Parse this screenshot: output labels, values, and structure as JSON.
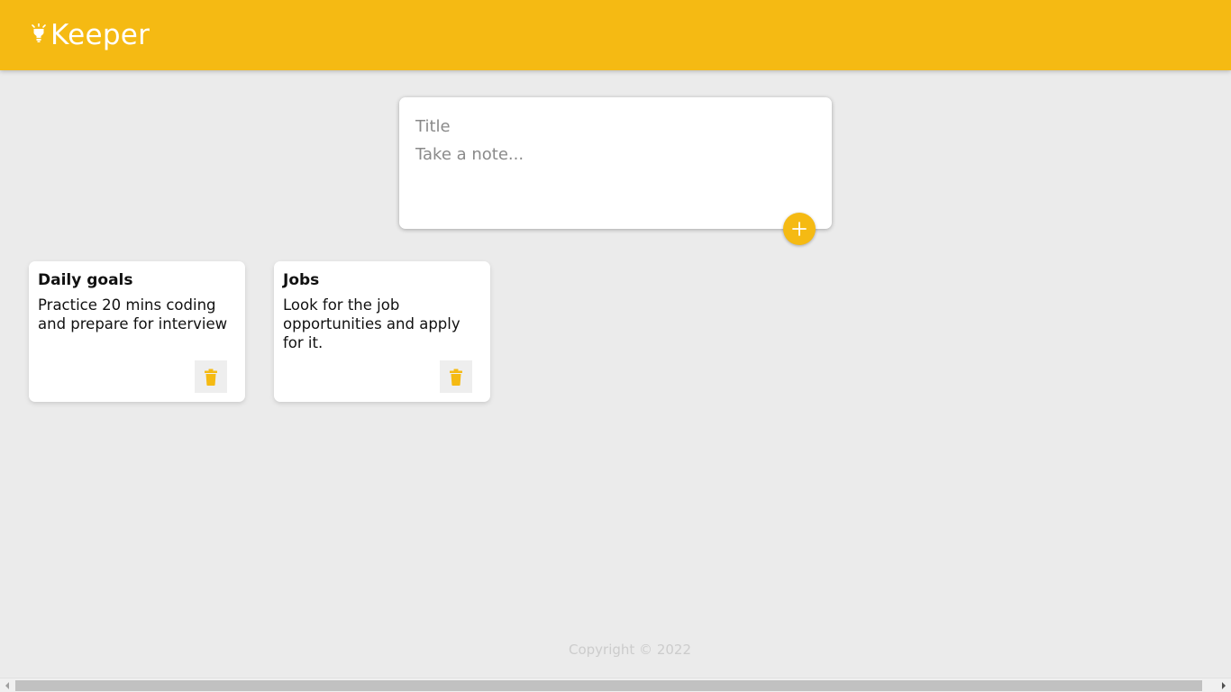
{
  "header": {
    "title": "Keeper",
    "icon": "lightbulb-icon"
  },
  "create_note": {
    "title_placeholder": "Title",
    "content_placeholder": "Take a note...",
    "add_icon": "plus-icon"
  },
  "notes": [
    {
      "title": "Daily goals",
      "content": "Practice 20 mins coding and prepare for interview",
      "delete_icon": "trash-icon"
    },
    {
      "title": "Jobs",
      "content": "Look for the job opportunities and apply for it.",
      "delete_icon": "trash-icon"
    }
  ],
  "footer": {
    "copyright": "Copyright © 2022"
  },
  "colors": {
    "accent": "#f5ba13",
    "background": "#ebebeb",
    "card": "#ffffff"
  }
}
